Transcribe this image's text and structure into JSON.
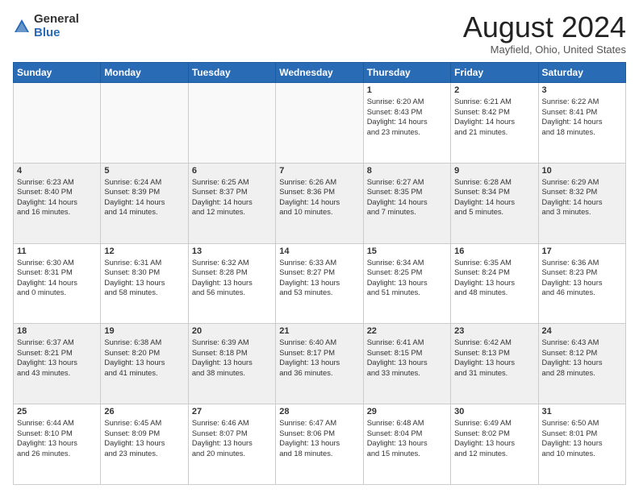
{
  "header": {
    "logo_general": "General",
    "logo_blue": "Blue",
    "month_title": "August 2024",
    "location": "Mayfield, Ohio, United States"
  },
  "days_of_week": [
    "Sunday",
    "Monday",
    "Tuesday",
    "Wednesday",
    "Thursday",
    "Friday",
    "Saturday"
  ],
  "weeks": [
    [
      {
        "day": "",
        "content": "",
        "empty": true
      },
      {
        "day": "",
        "content": "",
        "empty": true
      },
      {
        "day": "",
        "content": "",
        "empty": true
      },
      {
        "day": "",
        "content": "",
        "empty": true
      },
      {
        "day": "1",
        "content": "Sunrise: 6:20 AM\nSunset: 8:43 PM\nDaylight: 14 hours\nand 23 minutes.",
        "empty": false
      },
      {
        "day": "2",
        "content": "Sunrise: 6:21 AM\nSunset: 8:42 PM\nDaylight: 14 hours\nand 21 minutes.",
        "empty": false
      },
      {
        "day": "3",
        "content": "Sunrise: 6:22 AM\nSunset: 8:41 PM\nDaylight: 14 hours\nand 18 minutes.",
        "empty": false
      }
    ],
    [
      {
        "day": "4",
        "content": "Sunrise: 6:23 AM\nSunset: 8:40 PM\nDaylight: 14 hours\nand 16 minutes.",
        "empty": false
      },
      {
        "day": "5",
        "content": "Sunrise: 6:24 AM\nSunset: 8:39 PM\nDaylight: 14 hours\nand 14 minutes.",
        "empty": false
      },
      {
        "day": "6",
        "content": "Sunrise: 6:25 AM\nSunset: 8:37 PM\nDaylight: 14 hours\nand 12 minutes.",
        "empty": false
      },
      {
        "day": "7",
        "content": "Sunrise: 6:26 AM\nSunset: 8:36 PM\nDaylight: 14 hours\nand 10 minutes.",
        "empty": false
      },
      {
        "day": "8",
        "content": "Sunrise: 6:27 AM\nSunset: 8:35 PM\nDaylight: 14 hours\nand 7 minutes.",
        "empty": false
      },
      {
        "day": "9",
        "content": "Sunrise: 6:28 AM\nSunset: 8:34 PM\nDaylight: 14 hours\nand 5 minutes.",
        "empty": false
      },
      {
        "day": "10",
        "content": "Sunrise: 6:29 AM\nSunset: 8:32 PM\nDaylight: 14 hours\nand 3 minutes.",
        "empty": false
      }
    ],
    [
      {
        "day": "11",
        "content": "Sunrise: 6:30 AM\nSunset: 8:31 PM\nDaylight: 14 hours\nand 0 minutes.",
        "empty": false
      },
      {
        "day": "12",
        "content": "Sunrise: 6:31 AM\nSunset: 8:30 PM\nDaylight: 13 hours\nand 58 minutes.",
        "empty": false
      },
      {
        "day": "13",
        "content": "Sunrise: 6:32 AM\nSunset: 8:28 PM\nDaylight: 13 hours\nand 56 minutes.",
        "empty": false
      },
      {
        "day": "14",
        "content": "Sunrise: 6:33 AM\nSunset: 8:27 PM\nDaylight: 13 hours\nand 53 minutes.",
        "empty": false
      },
      {
        "day": "15",
        "content": "Sunrise: 6:34 AM\nSunset: 8:25 PM\nDaylight: 13 hours\nand 51 minutes.",
        "empty": false
      },
      {
        "day": "16",
        "content": "Sunrise: 6:35 AM\nSunset: 8:24 PM\nDaylight: 13 hours\nand 48 minutes.",
        "empty": false
      },
      {
        "day": "17",
        "content": "Sunrise: 6:36 AM\nSunset: 8:23 PM\nDaylight: 13 hours\nand 46 minutes.",
        "empty": false
      }
    ],
    [
      {
        "day": "18",
        "content": "Sunrise: 6:37 AM\nSunset: 8:21 PM\nDaylight: 13 hours\nand 43 minutes.",
        "empty": false
      },
      {
        "day": "19",
        "content": "Sunrise: 6:38 AM\nSunset: 8:20 PM\nDaylight: 13 hours\nand 41 minutes.",
        "empty": false
      },
      {
        "day": "20",
        "content": "Sunrise: 6:39 AM\nSunset: 8:18 PM\nDaylight: 13 hours\nand 38 minutes.",
        "empty": false
      },
      {
        "day": "21",
        "content": "Sunrise: 6:40 AM\nSunset: 8:17 PM\nDaylight: 13 hours\nand 36 minutes.",
        "empty": false
      },
      {
        "day": "22",
        "content": "Sunrise: 6:41 AM\nSunset: 8:15 PM\nDaylight: 13 hours\nand 33 minutes.",
        "empty": false
      },
      {
        "day": "23",
        "content": "Sunrise: 6:42 AM\nSunset: 8:13 PM\nDaylight: 13 hours\nand 31 minutes.",
        "empty": false
      },
      {
        "day": "24",
        "content": "Sunrise: 6:43 AM\nSunset: 8:12 PM\nDaylight: 13 hours\nand 28 minutes.",
        "empty": false
      }
    ],
    [
      {
        "day": "25",
        "content": "Sunrise: 6:44 AM\nSunset: 8:10 PM\nDaylight: 13 hours\nand 26 minutes.",
        "empty": false
      },
      {
        "day": "26",
        "content": "Sunrise: 6:45 AM\nSunset: 8:09 PM\nDaylight: 13 hours\nand 23 minutes.",
        "empty": false
      },
      {
        "day": "27",
        "content": "Sunrise: 6:46 AM\nSunset: 8:07 PM\nDaylight: 13 hours\nand 20 minutes.",
        "empty": false
      },
      {
        "day": "28",
        "content": "Sunrise: 6:47 AM\nSunset: 8:06 PM\nDaylight: 13 hours\nand 18 minutes.",
        "empty": false
      },
      {
        "day": "29",
        "content": "Sunrise: 6:48 AM\nSunset: 8:04 PM\nDaylight: 13 hours\nand 15 minutes.",
        "empty": false
      },
      {
        "day": "30",
        "content": "Sunrise: 6:49 AM\nSunset: 8:02 PM\nDaylight: 13 hours\nand 12 minutes.",
        "empty": false
      },
      {
        "day": "31",
        "content": "Sunrise: 6:50 AM\nSunset: 8:01 PM\nDaylight: 13 hours\nand 10 minutes.",
        "empty": false
      }
    ]
  ]
}
